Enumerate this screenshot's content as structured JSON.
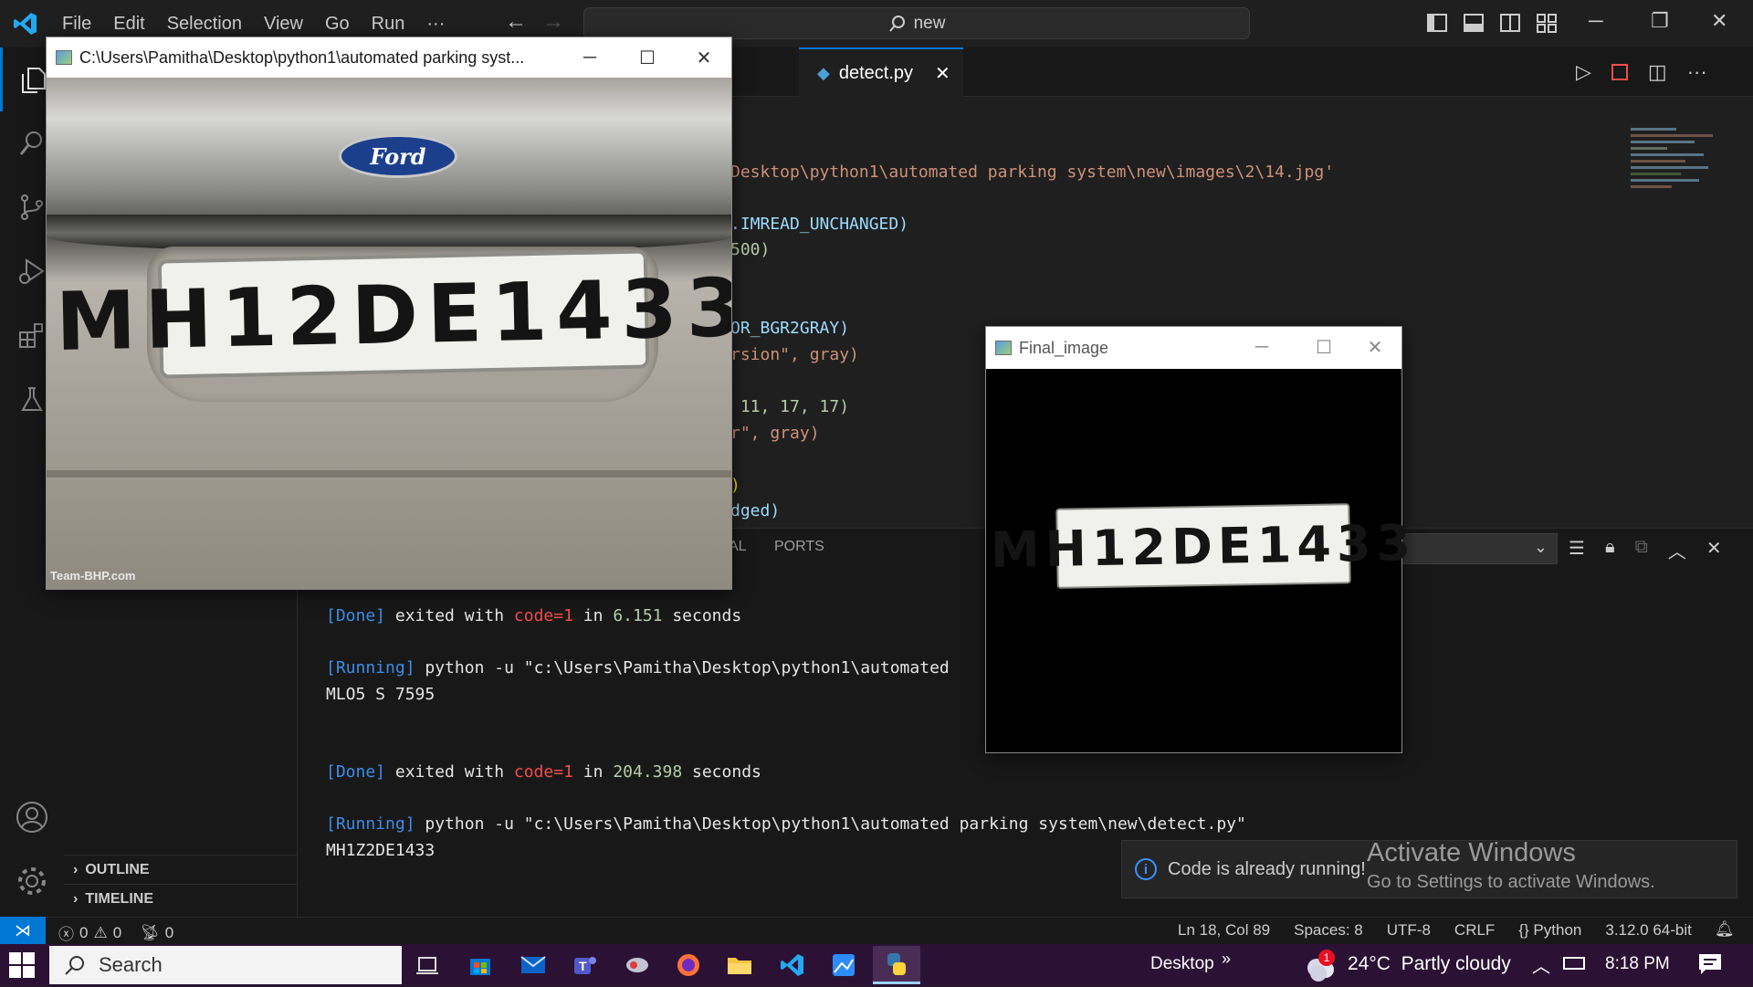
{
  "menu": [
    "File",
    "Edit",
    "Selection",
    "View",
    "Go",
    "Run",
    "···"
  ],
  "command_center": {
    "text": "new"
  },
  "editor_tab": {
    "label": "detect.py"
  },
  "code_lines": [
    {
      "text": "Desktop\\python1\\automated parking system\\new\\images\\2\\14.jpg'",
      "color": "#ce9178"
    },
    {
      "text": ".IMREAD_UNCHANGED)",
      "color": "#9cdcfe"
    },
    {
      "text": "500)",
      "color": "#b5cea8"
    },
    {
      "text": "OR_BGR2GRAY)",
      "color": "#9cdcfe"
    },
    {
      "text": "rsion\", gray)",
      "color": "#ce9178"
    },
    {
      "text": " 11, 17, 17)",
      "color": "#b5cea8"
    },
    {
      "text": "r\", gray)",
      "color": "#ce9178"
    },
    {
      "text": ")",
      "color": "#ffd700"
    },
    {
      "text": "dged)",
      "color": "#9cdcfe"
    }
  ],
  "panel": {
    "tab_partial": "AL",
    "tab_ports": "PORTS",
    "lines": [
      {
        "tag": "[Done]",
        "mid": " exited with ",
        "code": "code=1",
        "in": " in ",
        "time": "6.151",
        "tail": " seconds"
      },
      {
        "tag": "[Running]",
        "cmd": " python -u \"c:\\Users\\Pamitha\\Desktop\\python1\\automated"
      },
      {
        "out": "MLO5 S 7595"
      },
      {
        "tag": "[Done]",
        "mid": " exited with ",
        "code": "code=1",
        "in": " in ",
        "time": "204.398",
        "tail": " seconds"
      },
      {
        "tag": "[Running]",
        "cmd": " python -u \"c:\\Users\\Pamitha\\Desktop\\python1\\automated parking system\\new\\detect.py\""
      },
      {
        "out": "MH1Z2DE1433"
      }
    ]
  },
  "sidebar": {
    "outline": "OUTLINE",
    "timeline": "TIMELINE"
  },
  "window_car": {
    "title": "C:\\Users\\Pamitha\\Desktop\\python1\\automated parking syst...",
    "plate_text": "MH12DE1433",
    "brand": "Ford",
    "watermark": "Team-BHP.com"
  },
  "window_final": {
    "title": "Final_image",
    "plate_text": "MH12DE1433"
  },
  "notification": {
    "text": "Code is already running!"
  },
  "activate_windows": {
    "title": "Activate Windows",
    "subtitle": "Go to Settings to activate Windows."
  },
  "status": {
    "errors": "0",
    "warnings": "0",
    "ports": "0",
    "cursor": "Ln 18, Col 89",
    "spaces": "Spaces: 8",
    "encoding": "UTF-8",
    "eol": "CRLF",
    "language": "Python",
    "interpreter": "3.12.0 64-bit"
  },
  "taskbar": {
    "search": "Search",
    "desktop": "Desktop",
    "weather": "24°C  Partly cloudy",
    "weather_badge": "1",
    "time": "8:18 PM"
  },
  "colors": {
    "accent": "#0078d4",
    "taskbar": "#2b1134"
  }
}
